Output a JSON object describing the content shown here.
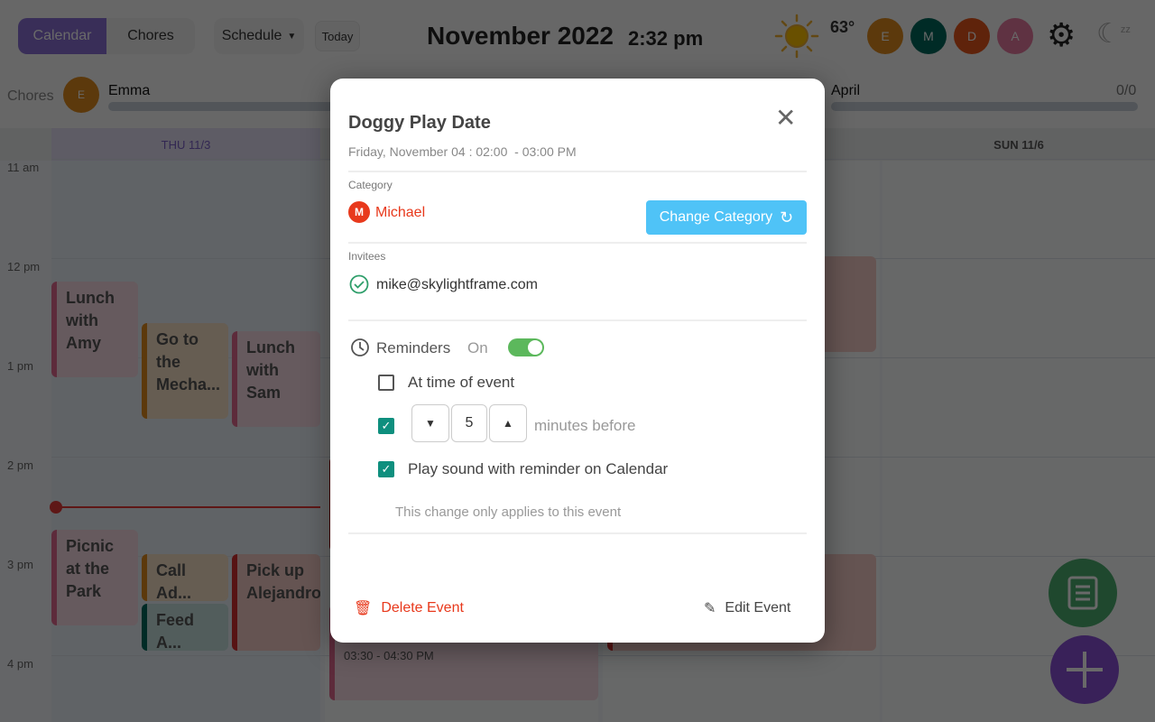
{
  "header": {
    "tabs": [
      "Calendar",
      "Chores"
    ],
    "active_tab": "Calendar",
    "view": "Schedule",
    "today": "Today",
    "month": "November 2022",
    "time": "2:32 pm",
    "temperature": "63°",
    "weather_icon": "sun-icon",
    "members": [
      {
        "initial": "E",
        "color": "#e08a1e"
      },
      {
        "initial": "M",
        "color": "#00695c"
      },
      {
        "initial": "D",
        "color": "#e8561c"
      },
      {
        "initial": "A",
        "color": "#e87aa0"
      }
    ]
  },
  "chores": {
    "label": "Chores",
    "people": [
      {
        "initial": "E",
        "name": "Emma",
        "color": "#e08a1e"
      },
      {
        "name": "April",
        "count": "0/0"
      }
    ]
  },
  "days": [
    "THU 11/3",
    "SUN 11/6"
  ],
  "hours": [
    "11 am",
    "12 pm",
    "1 pm",
    "2 pm",
    "3 pm",
    "4 pm"
  ],
  "events": [
    {
      "title": "Lunch with Amy",
      "color": "pink"
    },
    {
      "title": "Go to the Mecha...",
      "color": "orange"
    },
    {
      "title": "Lunch with Sam",
      "color": "pink"
    },
    {
      "title": "Picnic at the Park",
      "color": "pink"
    },
    {
      "title": "Call Ad...",
      "color": "orange"
    },
    {
      "title": "Feed A...",
      "color": "teal"
    },
    {
      "title": "Pick up Alejandro",
      "color": "red"
    },
    {
      "time": "03:30 - 04:30 PM",
      "color": "pink"
    }
  ],
  "modal": {
    "title": "Doggy Play Date",
    "datetime": "Friday, November 04 : 02:00  - 03:00 PM",
    "category_label": "Category",
    "category_initial": "M",
    "category_name": "Michael",
    "category_color": "#e8391c",
    "change_category": "Change Category",
    "invitees_label": "Invitees",
    "invitee": "mike@skylightframe.com",
    "reminders_label": "Reminders",
    "reminders_state": "On",
    "reminders_on": true,
    "options": [
      {
        "label": "At time of event",
        "checked": false
      },
      {
        "label": "minutes before",
        "checked": true,
        "value": "5"
      },
      {
        "label": "Play sound with reminder on Calendar",
        "checked": true
      }
    ],
    "note": "This change only applies to this event",
    "delete": "Delete Event",
    "edit": "Edit Event"
  }
}
